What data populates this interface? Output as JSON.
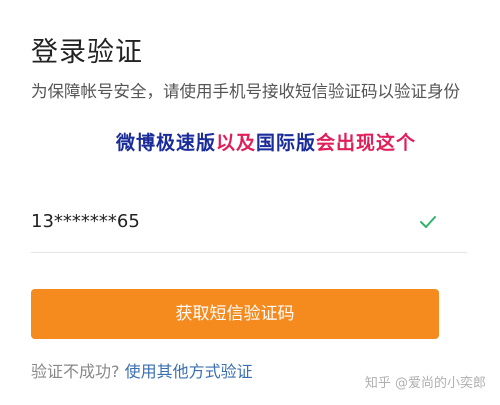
{
  "title": "登录验证",
  "description": "为保障帐号安全，请使用手机号接收短信验证码以验证身份",
  "annotation": {
    "segments": [
      {
        "text": "微博极速版",
        "color": "#1a2b9a"
      },
      {
        "text": "以及",
        "color": "#e01e5a"
      },
      {
        "text": "国际版",
        "color": "#1a2b9a"
      },
      {
        "text": "会出现这个",
        "color": "#e01e5a"
      }
    ]
  },
  "phone": {
    "value": "13*******65",
    "icon": "check-icon",
    "icon_color": "#2fb36b"
  },
  "button": {
    "label": "获取短信验证码",
    "color": "#f58a1f"
  },
  "footer": {
    "prompt": "验证不成功?",
    "link": "使用其他方式验证"
  },
  "watermark": "知乎 @爱尚的小奕郎"
}
